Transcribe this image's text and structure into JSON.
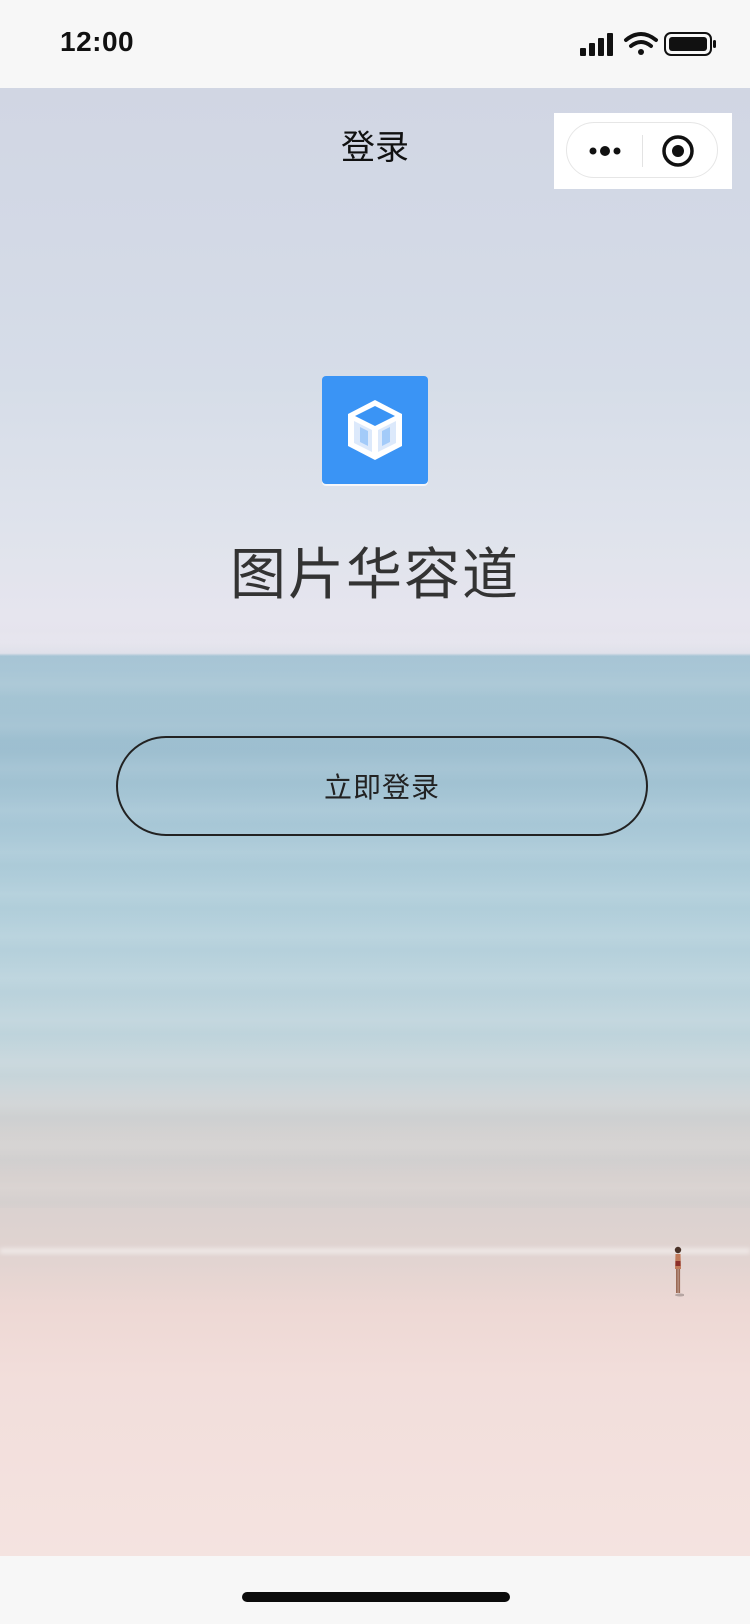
{
  "status_bar": {
    "time": "12:00",
    "icons": [
      "signal-icon",
      "wifi-icon",
      "battery-icon"
    ]
  },
  "nav": {
    "title": "登录",
    "capsule": [
      "more-icon",
      "close-target-icon"
    ]
  },
  "main": {
    "app_title": "图片华容道",
    "login_label": "立即登录",
    "logo_color": "#3a94f5",
    "logo_icon": "cube-icon"
  }
}
